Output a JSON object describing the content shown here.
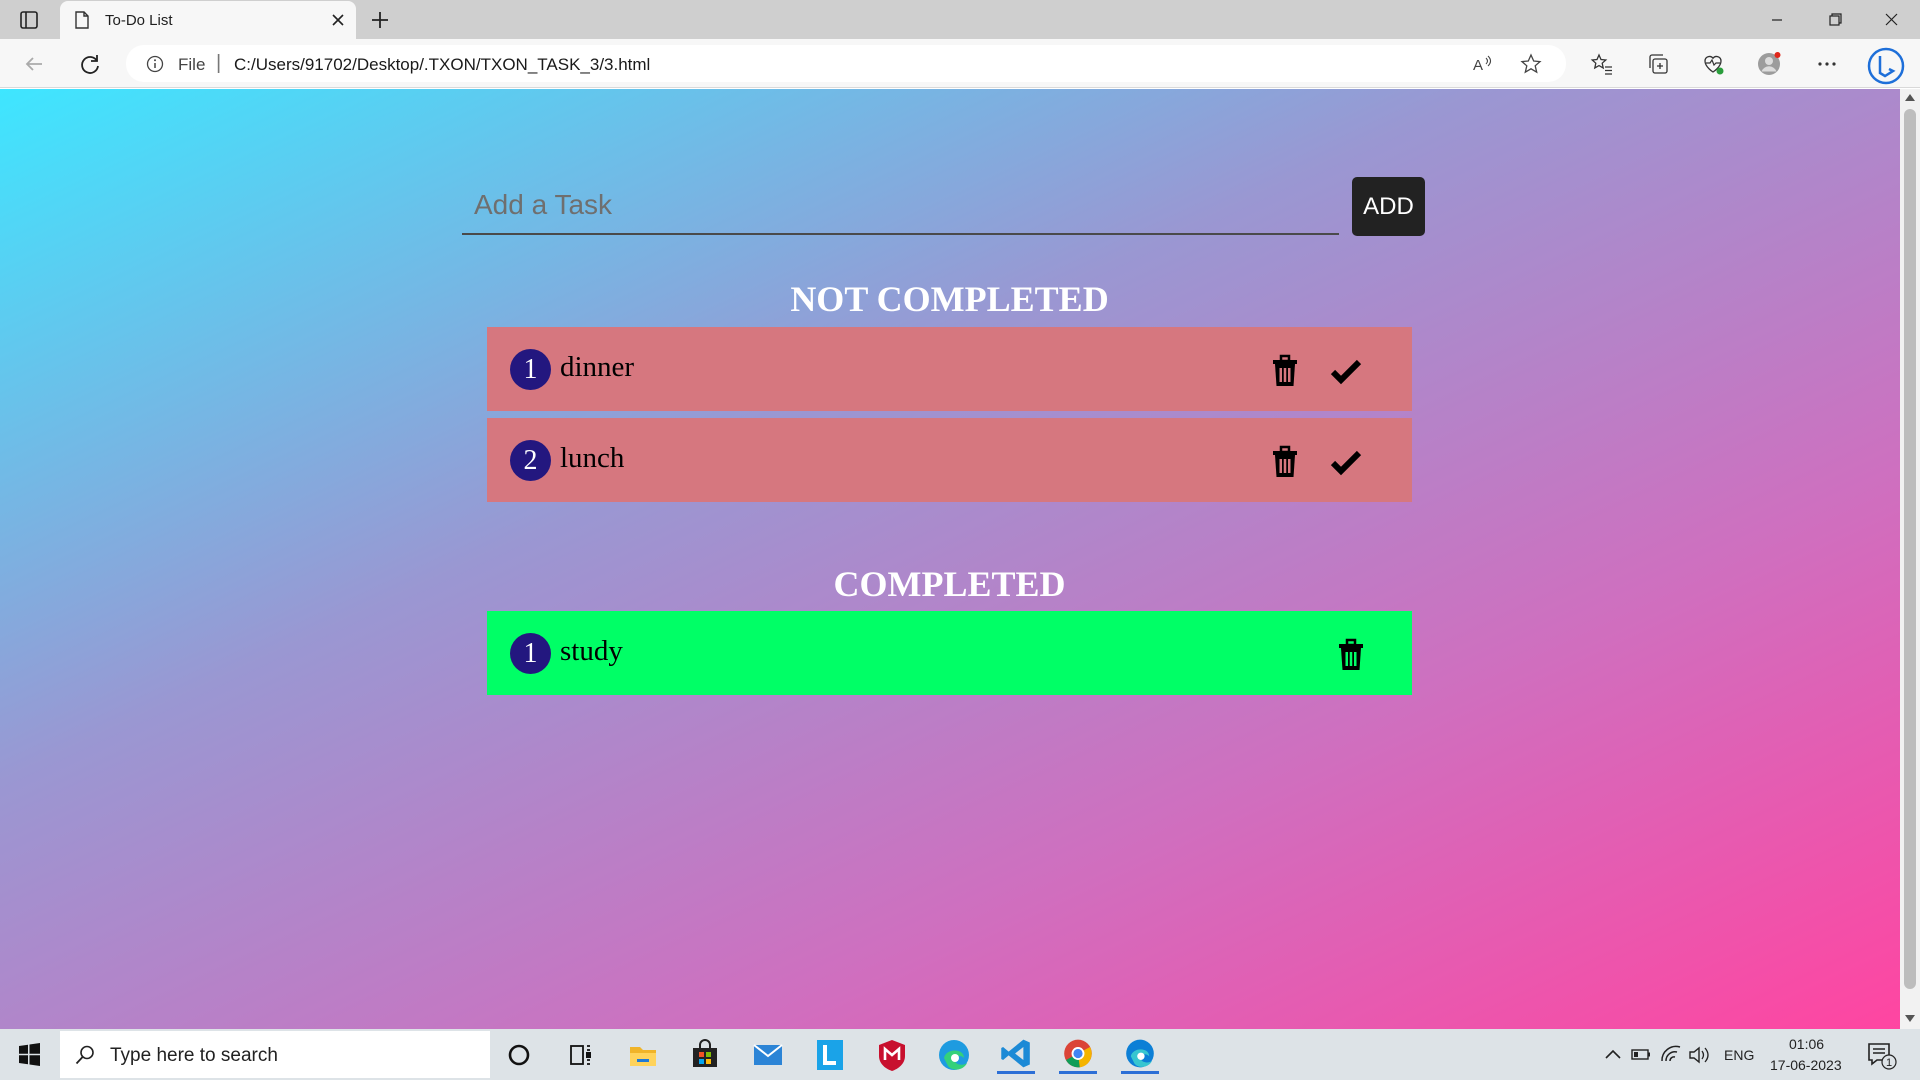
{
  "browser": {
    "tab_title": "To-Do List",
    "url_scheme_label": "File",
    "url": "C:/Users/91702/Desktop/.TXON/TXON_TASK_3/3.html"
  },
  "app": {
    "input_placeholder": "Add a Task",
    "add_label": "ADD",
    "sections": {
      "pending_title": "NOT COMPLETED",
      "done_title": "COMPLETED"
    },
    "pending_tasks": [
      {
        "number": "1",
        "text": "dinner"
      },
      {
        "number": "2",
        "text": "lunch"
      }
    ],
    "completed_tasks": [
      {
        "number": "1",
        "text": "study"
      }
    ],
    "colors": {
      "pending_row": "#d6777f",
      "done_row": "#00ff66",
      "number_badge": "#23177f",
      "add_button": "#222222"
    }
  },
  "taskbar": {
    "search_placeholder": "Type here to search",
    "language": "ENG",
    "time": "01:06",
    "date": "17-06-2023",
    "notification_count": "1",
    "apps": [
      "cortana-icon",
      "task-view-icon",
      "file-explorer-icon",
      "store-icon",
      "mail-icon",
      "app-l-icon",
      "mcafee-icon",
      "edge-icon",
      "vscode-icon",
      "chrome-icon",
      "edge-dev-icon"
    ]
  }
}
